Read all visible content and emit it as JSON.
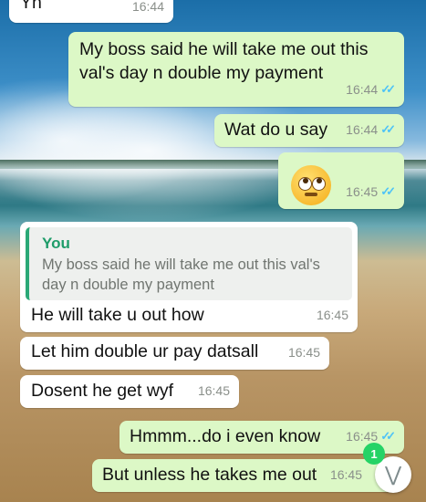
{
  "messages": [
    {
      "text": "Yh",
      "time": "16:44",
      "direction": "incoming"
    },
    {
      "text": "My boss said he will take me out this val's day n double my payment",
      "time": "16:44",
      "direction": "outgoing",
      "status": "read"
    },
    {
      "text": "Wat do u say",
      "time": "16:44",
      "direction": "outgoing",
      "status": "read"
    },
    {
      "emoji": "face-with-rolling-eyes",
      "time": "16:45",
      "direction": "outgoing",
      "status": "read"
    },
    {
      "quote_author": "You",
      "quote_text": "My boss said he will take me out this val's day n double my payment",
      "text": "He will take u out how",
      "time": "16:45",
      "direction": "incoming"
    },
    {
      "text": "Let him double ur pay datsall",
      "time": "16:45",
      "direction": "incoming"
    },
    {
      "text": "Dosent he get wyf",
      "time": "16:45",
      "direction": "incoming"
    },
    {
      "text": "Hmmm...do i even know",
      "time": "16:45",
      "direction": "outgoing",
      "status": "read"
    },
    {
      "text": "But unless he takes me out",
      "time": "16:45",
      "direction": "outgoing"
    }
  ],
  "unread_badge": "1",
  "colors": {
    "outgoing": "#dcf8c6",
    "incoming": "#ffffff",
    "read_ticks": "#4fc3f7",
    "quote_accent": "#2aa876"
  }
}
